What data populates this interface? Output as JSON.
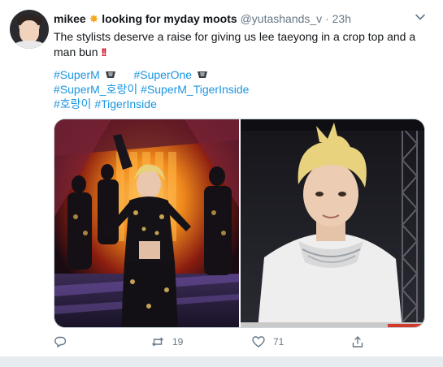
{
  "tweet": {
    "display_name": "mikee",
    "name_suffix": "looking for myday moots",
    "handle": "@yutashands_v",
    "separator": "·",
    "time": "23h",
    "text_main": "The stylists deserve a raise for giving us lee taeyong in a crop top and a man bun",
    "text_emoji": "!!",
    "hashtags": {
      "row1": [
        "#SuperM",
        "#SuperOne"
      ],
      "row2": [
        "#SuperM_호랑이",
        "#SuperM_TigerInside"
      ],
      "row3": [
        "#호랑이",
        "#TigerInside"
      ]
    },
    "media_icons": [
      "photo-stage-icon",
      "photo-closeup-icon"
    ],
    "actions": {
      "reply_count": "",
      "retweet_count": "19",
      "like_count": "71"
    }
  },
  "colors": {
    "link": "#1b95e0",
    "secondary_text": "#657786",
    "primary_text": "#14171a",
    "star": "#f5a623",
    "emphasis": "#d0021b"
  }
}
